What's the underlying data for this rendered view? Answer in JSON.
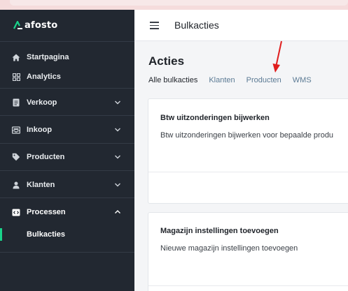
{
  "brand": {
    "name": "afosto",
    "accent": "#19d38a"
  },
  "sidebar": {
    "items": [
      {
        "label": "Startpagina",
        "icon": "home-icon"
      },
      {
        "label": "Analytics",
        "icon": "grid-icon"
      },
      {
        "label": "Verkoop",
        "icon": "document-icon",
        "expanded": false
      },
      {
        "label": "Inkoop",
        "icon": "inbox-icon",
        "expanded": false
      },
      {
        "label": "Producten",
        "icon": "tag-icon",
        "expanded": false
      },
      {
        "label": "Klanten",
        "icon": "user-icon",
        "expanded": false
      },
      {
        "label": "Processen",
        "icon": "code-icon",
        "expanded": true
      }
    ],
    "sub_items": [
      {
        "label": "Bulkacties",
        "active": true
      }
    ]
  },
  "header": {
    "title": "Bulkacties",
    "menu_icon": "hamburger-icon"
  },
  "main": {
    "title": "Acties",
    "tabs": [
      {
        "label": "Alle bulkacties",
        "active": true
      },
      {
        "label": "Klanten",
        "active": false
      },
      {
        "label": "Producten",
        "active": false
      },
      {
        "label": "WMS",
        "active": false
      }
    ],
    "cards": [
      {
        "title": "Btw uitzonderingen bijwerken",
        "description": "Btw uitzonderingen bijwerken voor bepaalde produ"
      },
      {
        "title": "Magazijn instellingen toevoegen",
        "description": "Nieuwe magazijn instellingen toevoegen"
      }
    ]
  }
}
